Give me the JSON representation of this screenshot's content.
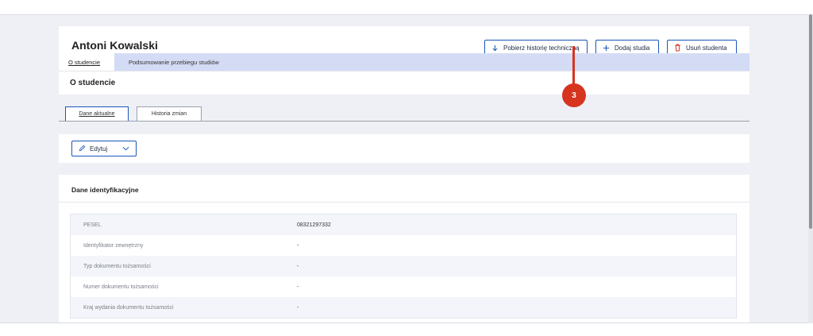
{
  "student": {
    "name": "Antoni Kowalski"
  },
  "header_buttons": {
    "download_history": "Pobierz historię techniczną",
    "add_studies": "Dodaj studia",
    "delete_student": "Usuń studenta"
  },
  "nav_tabs": [
    {
      "label": "O studencie",
      "active": true
    },
    {
      "label": "Podsumowanie przebiegu studiów",
      "active": false
    }
  ],
  "section": {
    "title": "O studencie"
  },
  "sub_tabs": [
    {
      "label": "Dane aktualne",
      "active": true
    },
    {
      "label": "Historia zmian",
      "active": false
    }
  ],
  "edit": {
    "label": "Edytuj"
  },
  "identification": {
    "title": "Dane identyfikacyjne",
    "rows": [
      {
        "label": "PESEL",
        "value": "08321297332"
      },
      {
        "label": "Identyfikator zewnętrzny",
        "value": "-"
      },
      {
        "label": "Typ dokumentu tożsamości",
        "value": "-"
      },
      {
        "label": "Numer dokumentu tożsamości",
        "value": "-"
      },
      {
        "label": "Kraj wydania dokumentu tożsamości",
        "value": "-"
      }
    ]
  },
  "callout": {
    "number": "3"
  },
  "colors": {
    "accent": "#1a56b8",
    "danger": "#d6341f",
    "nav_bg": "#d4dcf5",
    "page_bg": "#eef0f5"
  },
  "icons": {
    "download": "arrow-down-icon",
    "add": "plus-icon",
    "delete": "trash-icon",
    "edit": "pencil-icon",
    "dropdown": "chevron-down-icon"
  }
}
